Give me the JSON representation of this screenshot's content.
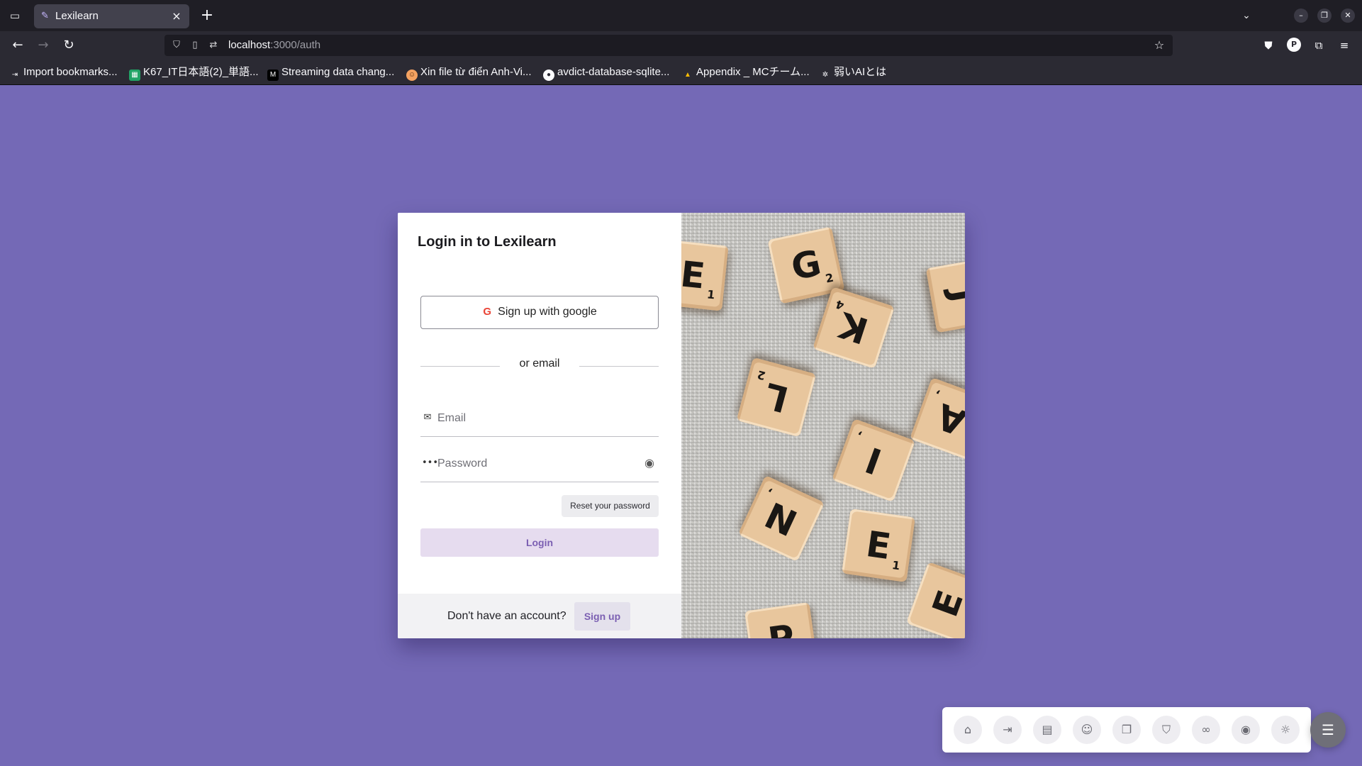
{
  "browser": {
    "tab_title": "Lexilearn",
    "url_host": "localhost",
    "url_path": ":3000/auth",
    "profile_initial": "P",
    "bookmarks": [
      {
        "label": "Import bookmarks...",
        "icon": "import-icon",
        "color": "#2b2a33"
      },
      {
        "label": "K67_IT日本語(2)_単語...",
        "icon": "sheets-icon",
        "color": "#21a366"
      },
      {
        "label": "Streaming data chang...",
        "icon": "medium-icon",
        "color": "#000000"
      },
      {
        "label": "Xin file từ điển Anh-Vi...",
        "icon": "avatar-icon",
        "color": "#f4a261"
      },
      {
        "label": "avdict-database-sqlite...",
        "icon": "github-icon",
        "color": "#fbfbfe"
      },
      {
        "label": "Appendix _ MCチーム...",
        "icon": "drive-icon",
        "color": "#fbbc04"
      },
      {
        "label": "弱いAIとは",
        "icon": "openai-icon",
        "color": "#fbfbfe"
      }
    ]
  },
  "auth": {
    "title": "Login in to Lexilearn",
    "google_button": "Sign up with google",
    "google_glyph": "G",
    "divider": "or email",
    "email_placeholder": "Email",
    "password_placeholder": "Password",
    "reset_button": "Reset your password",
    "login_button": "Login",
    "footer_question": "Don't have an account?",
    "signup_button": "Sign up",
    "accent_color": "#7b5fb2"
  },
  "hero_tiles": [
    {
      "letter": "E",
      "points": "1"
    },
    {
      "letter": "G",
      "points": "2"
    },
    {
      "letter": "K",
      "points": "4"
    },
    {
      "letter": "L",
      "points": "2"
    },
    {
      "letter": "I",
      "points": ","
    },
    {
      "letter": "A",
      "points": ","
    },
    {
      "letter": "N",
      "points": ","
    },
    {
      "letter": "E",
      "points": "1"
    },
    {
      "letter": "E",
      "points": ""
    },
    {
      "letter": "J",
      "points": ""
    },
    {
      "letter": "P",
      "points": ""
    }
  ],
  "dock": {
    "buttons": [
      "home-icon",
      "login-icon",
      "document-icon",
      "user-icon",
      "library-icon",
      "shield-icon",
      "meta-icon",
      "github-icon",
      "sun-icon"
    ],
    "main": "settings-sliders-icon"
  },
  "colors": {
    "page_background": "#7469b6",
    "login_button_bg": "#e6dcef"
  }
}
